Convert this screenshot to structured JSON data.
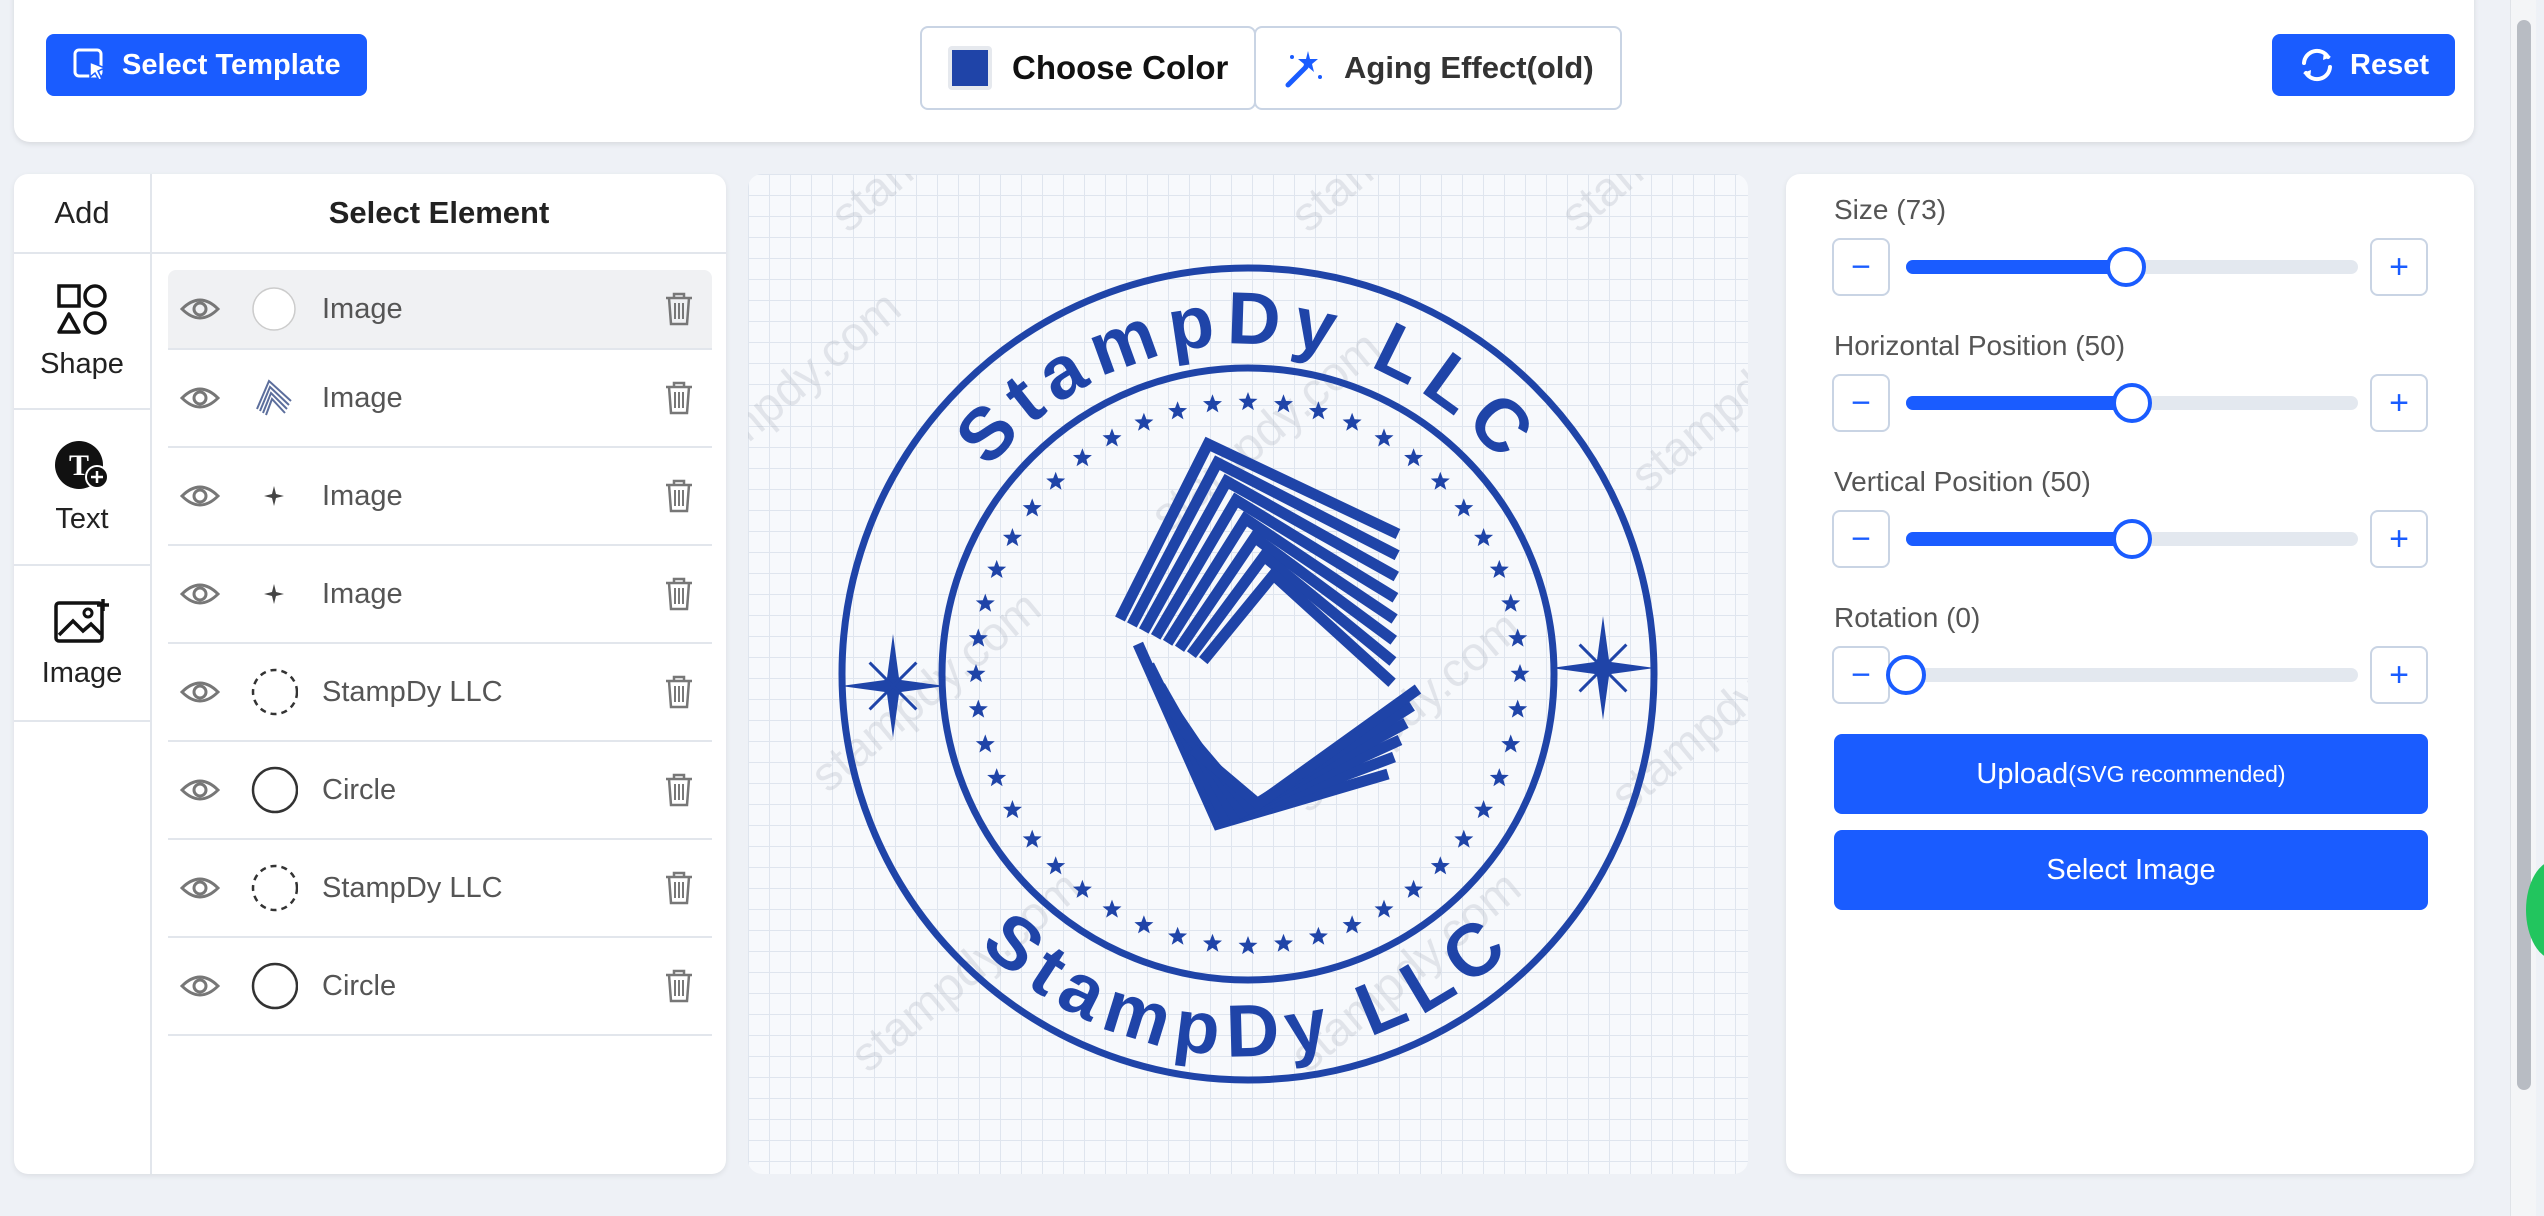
{
  "toolbar": {
    "select_template": "Select Template",
    "choose_color": "Choose Color",
    "aging_effect": "Aging Effect(old)",
    "reset": "Reset",
    "color_swatch": "#1f44a8"
  },
  "add_panel": {
    "title": "Add",
    "items": [
      {
        "label": "Shape",
        "icon": "shapes-icon"
      },
      {
        "label": "Text",
        "icon": "text-add-icon"
      },
      {
        "label": "Image",
        "icon": "image-add-icon"
      }
    ]
  },
  "elements_panel": {
    "title": "Select Element",
    "rows": [
      {
        "label": "Image",
        "thumb": "blank-circle"
      },
      {
        "label": "Image",
        "thumb": "building-logo"
      },
      {
        "label": "Image",
        "thumb": "sparkle"
      },
      {
        "label": "Image",
        "thumb": "sparkle"
      },
      {
        "label": "StampDy LLC",
        "thumb": "dashed-circle"
      },
      {
        "label": "Circle",
        "thumb": "circle"
      },
      {
        "label": "StampDy LLC",
        "thumb": "dashed-circle"
      },
      {
        "label": "Circle",
        "thumb": "circle"
      }
    ]
  },
  "stamp": {
    "top_text": "StampDy LLC",
    "bottom_text": "StampDy LLC",
    "color": "#1f44a8",
    "watermark": "stampdy.com"
  },
  "controls": {
    "size_label": "Size (73)",
    "size_value": 73,
    "hpos_label": "Horizontal Position (50)",
    "hpos_value": 50,
    "vpos_label": "Vertical Position (50)",
    "vpos_value": 50,
    "rotation_label": "Rotation (0)",
    "rotation_value": 0,
    "upload_label": "Upload",
    "upload_hint": "(SVG recommended)",
    "select_image": "Select Image"
  },
  "colors": {
    "primary": "#1a5cff",
    "stamp": "#1f44a8"
  }
}
